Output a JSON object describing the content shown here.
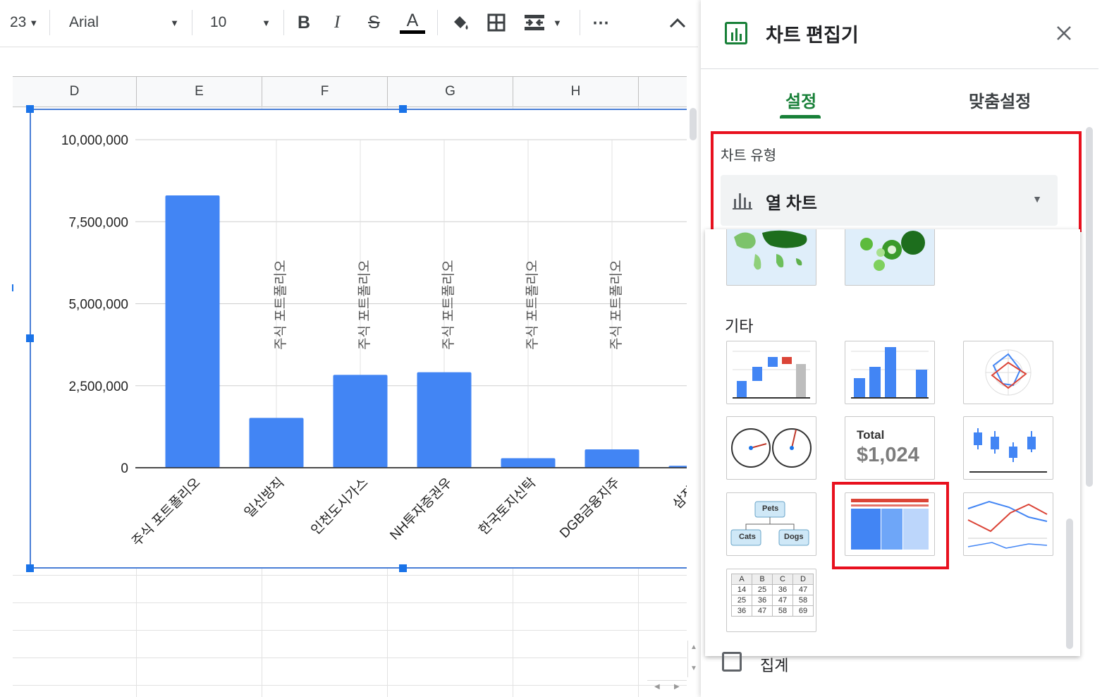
{
  "toolbar": {
    "number_format": "23",
    "font_name": "Arial",
    "font_size": "10",
    "bold": "B",
    "italic": "I",
    "strike": "S",
    "text_color_letter": "A"
  },
  "sheet": {
    "columns": [
      "D",
      "E",
      "F",
      "G",
      "H"
    ]
  },
  "chart_data": {
    "type": "bar",
    "categories": [
      "주식 포트폴리오",
      "일신방직",
      "인천도시가스",
      "NH투자증권우",
      "한국토지신탁",
      "DGB금융지주",
      "삼진제"
    ],
    "values": [
      8300000,
      1520000,
      2830000,
      2910000,
      290000,
      560000,
      60000
    ],
    "ylim": [
      0,
      10000000
    ],
    "yticks": [
      "10,000,000",
      "7,500,000",
      "5,000,000",
      "2,500,000",
      "0"
    ],
    "annotation": "주식 포트폴리오",
    "color": "#4285f4",
    "grid": true
  },
  "panel": {
    "title": "차트 편집기",
    "tabs": [
      "설정",
      "맞춤설정"
    ],
    "chart_type_label": "차트 유형",
    "chart_type_value": "열 차트",
    "other_label": "기타",
    "scorecard_label": "Total",
    "scorecard_value": "$1,024",
    "org_labels": [
      "Pets",
      "Cats",
      "Dogs"
    ],
    "table_header": [
      "A",
      "B",
      "C",
      "D"
    ],
    "table_rows": [
      [
        "14",
        "25",
        "36",
        "47"
      ],
      [
        "25",
        "36",
        "47",
        "58"
      ],
      [
        "36",
        "47",
        "58",
        "69"
      ]
    ],
    "aggregate_label": "집계",
    "accent": "#188038",
    "highlight": "#e8101e"
  }
}
